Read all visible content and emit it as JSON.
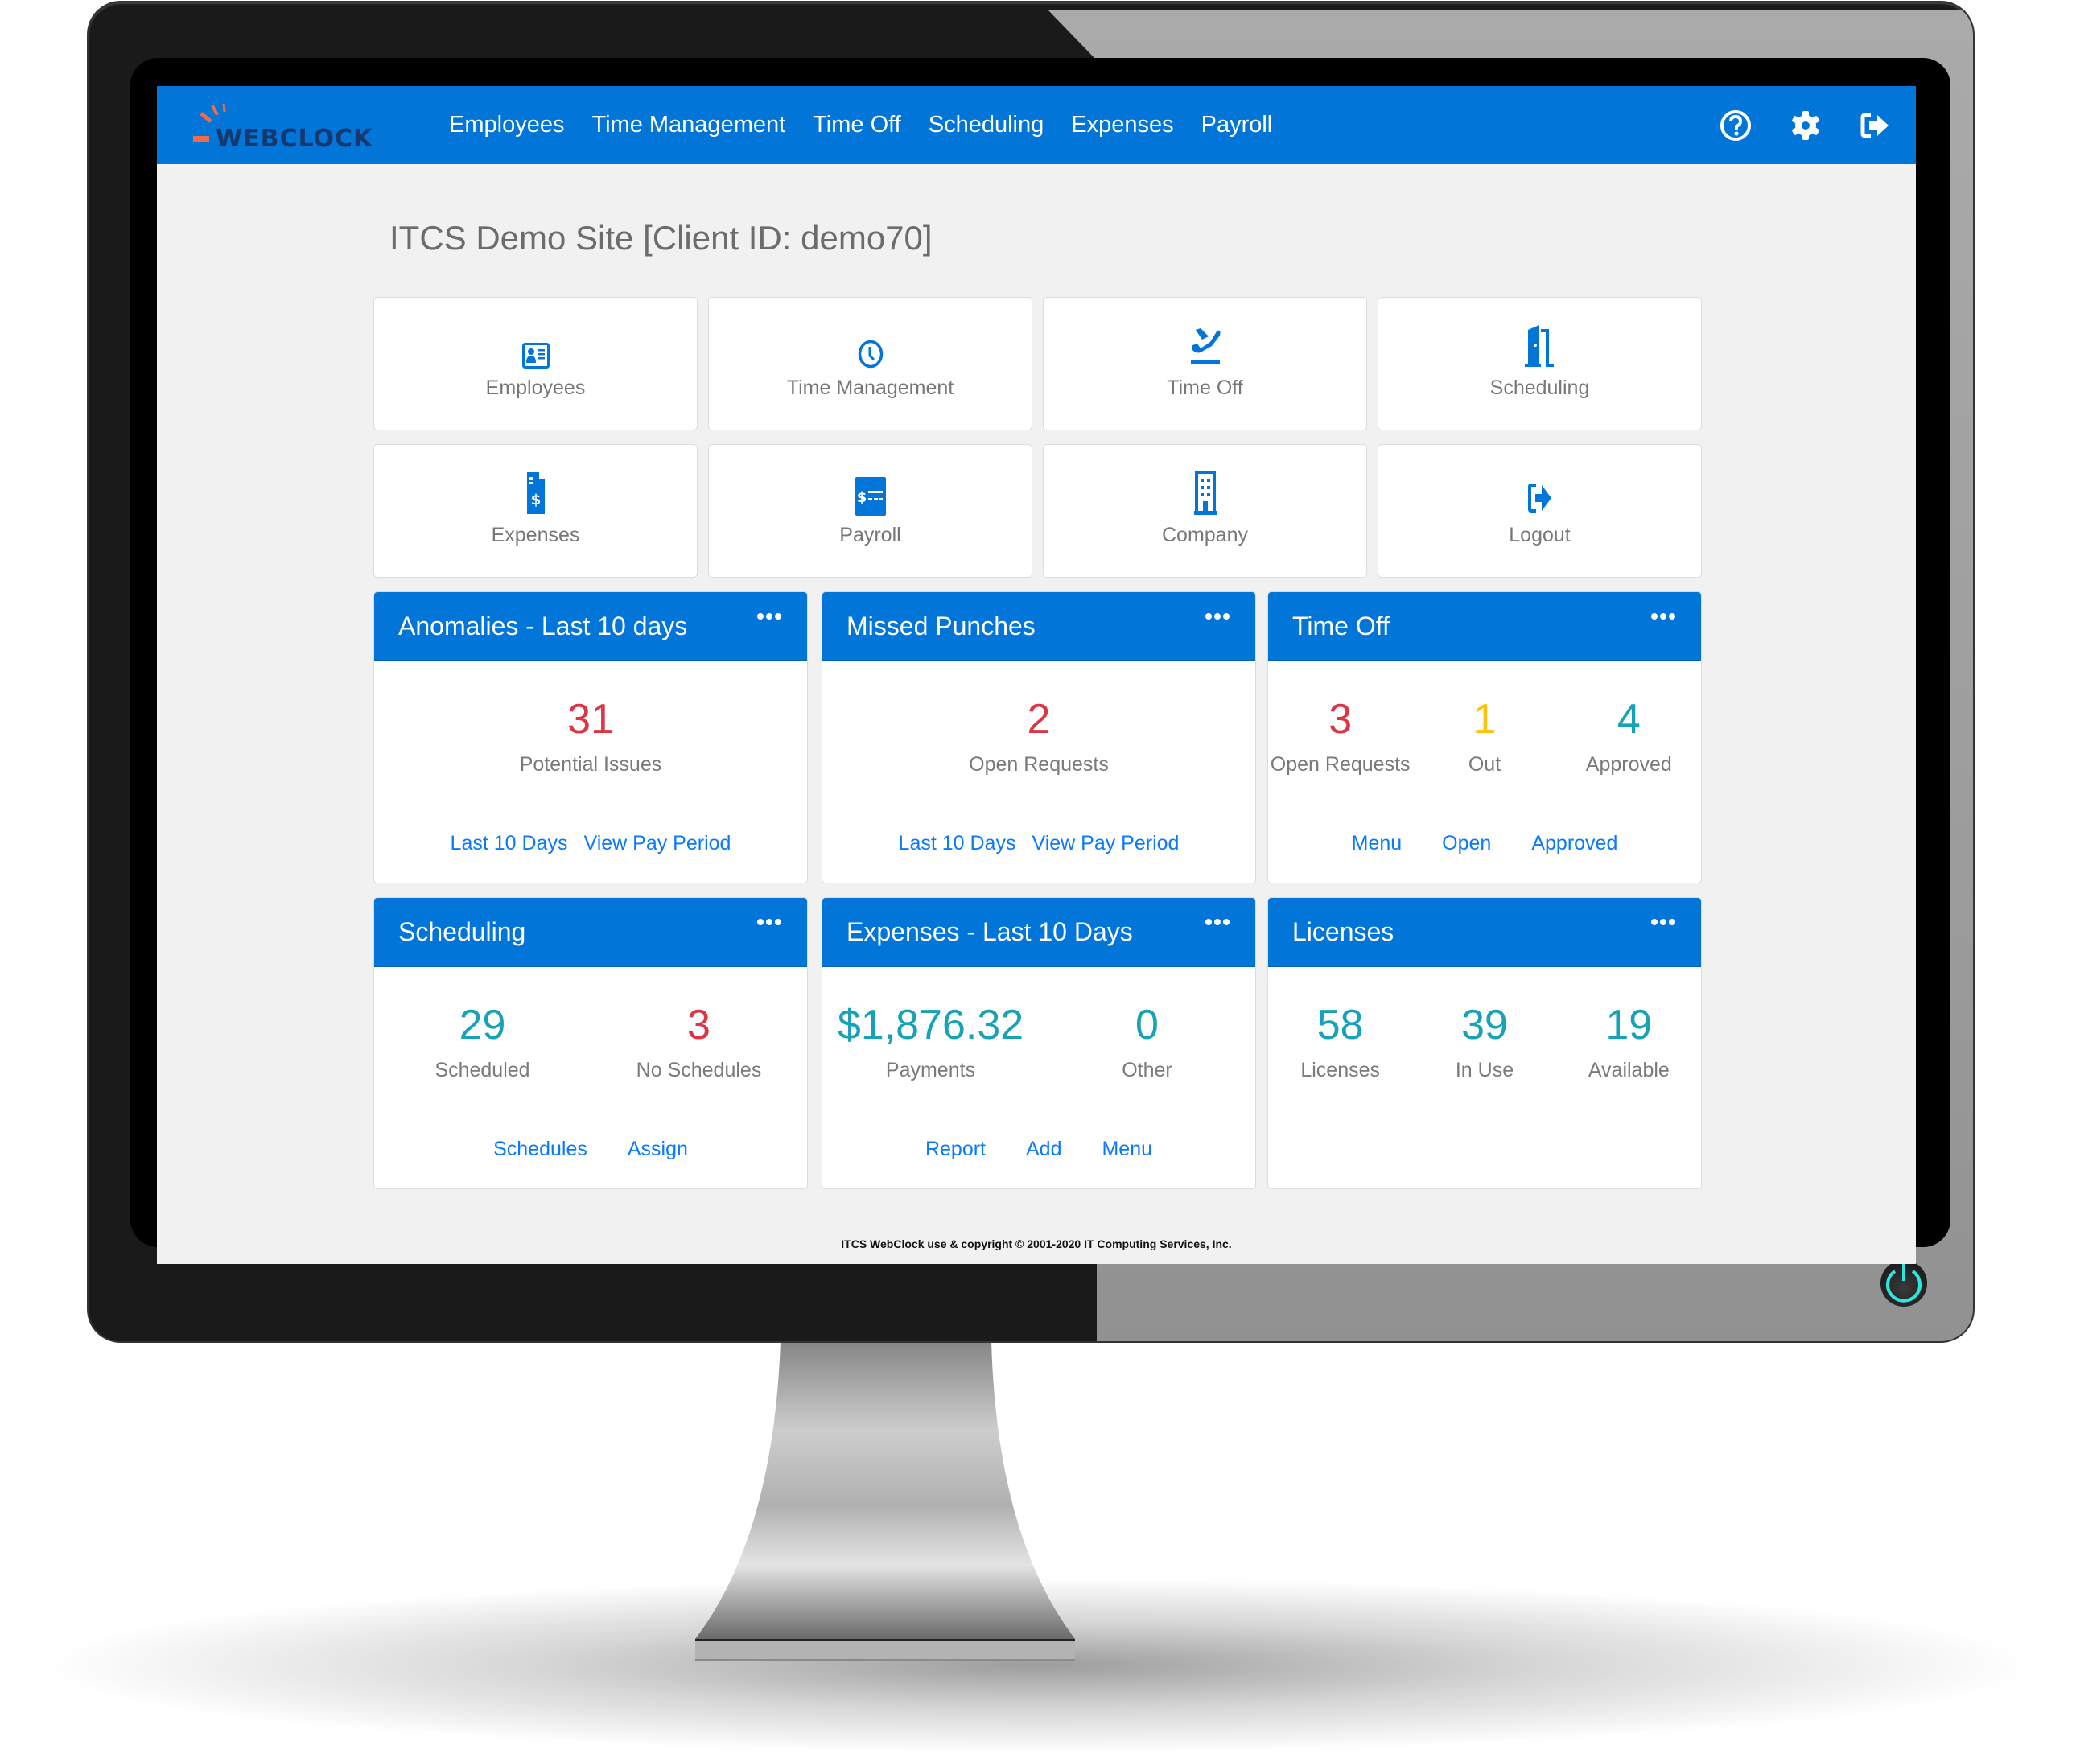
{
  "app": {
    "logo_text": "WEBCLOCK",
    "brand_color": "#0275d8",
    "logo_accent_color": "#ef6c4a"
  },
  "nav": {
    "links": [
      "Employees",
      "Time Management",
      "Time Off",
      "Scheduling",
      "Expenses",
      "Payroll"
    ],
    "icons": [
      "help-icon",
      "gear-icon",
      "logout-icon"
    ]
  },
  "page": {
    "title": "ITCS Demo Site [Client ID: demo70]"
  },
  "tiles": [
    {
      "label": "Employees",
      "icon": "id-card-icon"
    },
    {
      "label": "Time Management",
      "icon": "clock-icon"
    },
    {
      "label": "Time Off",
      "icon": "plane-departure-icon"
    },
    {
      "label": "Scheduling",
      "icon": "door-open-icon"
    },
    {
      "label": "Expenses",
      "icon": "invoice-dollar-icon"
    },
    {
      "label": "Payroll",
      "icon": "money-check-icon"
    },
    {
      "label": "Company",
      "icon": "building-icon"
    },
    {
      "label": "Logout",
      "icon": "sign-out-icon"
    }
  ],
  "colors": {
    "red": "#dc3545",
    "amber": "#ffc107",
    "teal": "#17a2b8",
    "link": "#0a7af7"
  },
  "widgets": {
    "anomalies": {
      "title": "Anomalies - Last 10 days",
      "stats": [
        {
          "value": "31",
          "label": "Potential Issues",
          "color": "red"
        }
      ],
      "links": [
        "Last 10 Days",
        "View Pay Period"
      ]
    },
    "missed_punches": {
      "title": "Missed Punches",
      "stats": [
        {
          "value": "2",
          "label": "Open Requests",
          "color": "red"
        }
      ],
      "links": [
        "Last 10 Days",
        "View Pay Period"
      ]
    },
    "time_off": {
      "title": "Time Off",
      "stats": [
        {
          "value": "3",
          "label": "Open Requests",
          "color": "red"
        },
        {
          "value": "1",
          "label": "Out",
          "color": "amber"
        },
        {
          "value": "4",
          "label": "Approved",
          "color": "teal"
        }
      ],
      "links": [
        "Menu",
        "Open",
        "Approved"
      ]
    },
    "scheduling": {
      "title": "Scheduling",
      "stats": [
        {
          "value": "29",
          "label": "Scheduled",
          "color": "teal"
        },
        {
          "value": "3",
          "label": "No Schedules",
          "color": "red"
        }
      ],
      "links": [
        "Schedules",
        "Assign"
      ]
    },
    "expenses": {
      "title": "Expenses - Last 10 Days",
      "stats": [
        {
          "value": "$1,876.32",
          "label": "Payments",
          "color": "teal"
        },
        {
          "value": "0",
          "label": "Other",
          "color": "teal"
        }
      ],
      "links": [
        "Report",
        "Add",
        "Menu"
      ]
    },
    "licenses": {
      "title": "Licenses",
      "stats": [
        {
          "value": "58",
          "label": "Licenses",
          "color": "teal"
        },
        {
          "value": "39",
          "label": "In Use",
          "color": "teal"
        },
        {
          "value": "19",
          "label": "Available",
          "color": "teal"
        }
      ],
      "links": []
    }
  },
  "footer": {
    "text": "ITCS WebClock use & copyright © 2001-2020 IT Computing Services, Inc."
  }
}
